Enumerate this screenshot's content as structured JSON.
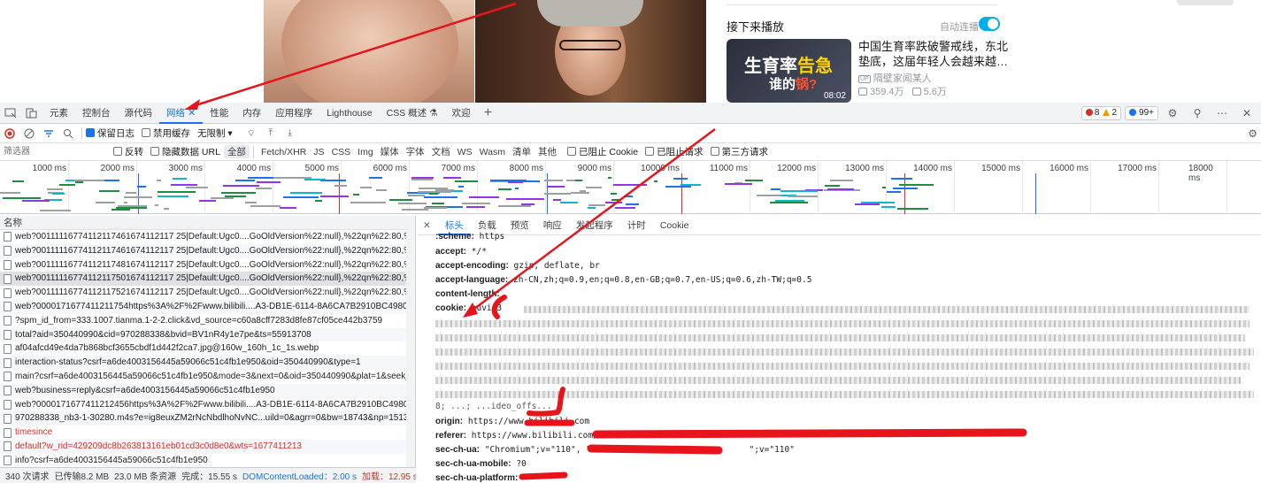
{
  "page": {
    "upnext_title": "接下来播放",
    "autoplay_label": "自动连播",
    "thumb_title_a": "生育率",
    "thumb_title_b": "告急",
    "thumb_sub_a": "谁的",
    "thumb_sub_b": "锅?",
    "thumb_duration": "08:02",
    "video_title": "中国生育率跌破警戒线，东北垫底，这届年轻人会越来越…",
    "video_up": "隔壁家闻某人",
    "video_views": "359.4万",
    "video_comments": "5.6万"
  },
  "devtools": {
    "tabs": [
      "元素",
      "控制台",
      "源代码",
      "网络",
      "性能",
      "内存",
      "应用程序",
      "Lighthouse",
      "CSS 概述",
      "欢迎"
    ],
    "active_tab": "网络",
    "errors": "8",
    "warnings": "2",
    "messages": "99+"
  },
  "toolbar": {
    "preserve_log": "保留日志",
    "disable_cache": "禁用缓存",
    "throttle": "无限制"
  },
  "filter": {
    "placeholder": "筛选器",
    "invert": "反转",
    "hide_data_urls": "隐藏数据 URL",
    "types": [
      "全部",
      "Fetch/XHR",
      "JS",
      "CSS",
      "Img",
      "媒体",
      "字体",
      "文档",
      "WS",
      "Wasm",
      "清单",
      "其他"
    ],
    "blocked_cookies": "已阻止 Cookie",
    "blocked_requests": "已阻止请求",
    "third_party": "第三方请求"
  },
  "timeline": {
    "ticks": [
      "1000 ms",
      "2000 ms",
      "3000 ms",
      "4000 ms",
      "5000 ms",
      "6000 ms",
      "7000 ms",
      "8000 ms",
      "9000 ms",
      "10000 ms",
      "11000 ms",
      "12000 ms",
      "13000 ms",
      "14000 ms",
      "15000 ms",
      "16000 ms",
      "17000 ms",
      "18000 ms"
    ]
  },
  "requests": {
    "column_name": "名称",
    "rows": [
      {
        "name": "web?00111116774112117461674112117 25|Default:Ugc0....GoOldVersion%22:null},%22qn%22:80,%22aq%22:30"
      },
      {
        "name": "web?00111116774112117461674112117 25|Default:Ugc0....GoOldVersion%22:null},%22qn%22:80,%22aq%22:30"
      },
      {
        "name": "web?00111116774112117481674112117 25|Default:Ugc0....GoOldVersion%22:null},%22qn%22:80,%22aq%22:30"
      },
      {
        "name": "web?00111116774112117501674112117 25|Default:Ugc0....GoOldVersion%22:null},%22qn%22:80,%22aq%22:30",
        "selected": true
      },
      {
        "name": "web?00111116774112117521674112117 25|Default:Ugc0....GoOldVersion%22:null},%22qn%22:80,%22aq%22:30"
      },
      {
        "name": "web?0000171677411211754https%3A%2F%2Fwww.bilibili....A3-DB1E-6114-8A6CA7B2910BC49804infoc|zh-CN|."
      },
      {
        "name": "?spm_id_from=333.1007.tianma.1-2-2.click&vd_source=c60a8cff7283d8fe87cf05ce442b3759"
      },
      {
        "name": "total?aid=350440990&cid=970288338&bvid=BV1nR4y1e7pe&ts=55913708"
      },
      {
        "name": "af04afcd49e4da7b868bcf3655cbdf1d442f2ca7.jpg@160w_160h_1c_1s.webp"
      },
      {
        "name": "interaction-status?csrf=a6de4003156445a59066c51c4fb1e950&oid=350440990&type=1"
      },
      {
        "name": "main?csrf=a6de4003156445a59066c51c4fb1e950&mode=3&next=0&oid=350440990&plat=1&seek_rpid=&ty."
      },
      {
        "name": "web?business=reply&csrf=a6de4003156445a59066c51c4fb1e950"
      },
      {
        "name": "web?0000171677411212456https%3A%2F%2Fwww.bilibili....A3-DB1E-6114-8A6CA7B2910BC49804infoc|zh-CN|."
      },
      {
        "name": "970288338_nb3-1-30280.m4s?e=ig8euxZM2rNcNbdlhoNvNC...uild=0&agrr=0&bw=18743&np=151388248&lo"
      },
      {
        "name": "timesince",
        "error": true
      },
      {
        "name": "default?w_rid=429209dc8b263813161eb01cd3c0d8e0&wts=1677411213",
        "error": true
      },
      {
        "name": "info?csrf=a6de4003156445a59066c51c4fb1e950"
      }
    ]
  },
  "status": {
    "requests": "340 次请求",
    "transferred": "已传输8.2 MB",
    "resources": "23.0 MB 条资源",
    "finish": "完成：15.55 s",
    "dcl": "DOMContentLoaded：2.00 s",
    "load": "加载：12.95 s"
  },
  "detail": {
    "tabs": [
      "标头",
      "负载",
      "预览",
      "响应",
      "发起程序",
      "计时",
      "Cookie"
    ],
    "active_tab": "标头",
    "headers": [
      {
        "key": ":scheme:",
        "value": "https"
      },
      {
        "key": "accept:",
        "value": "*/*"
      },
      {
        "key": "accept-encoding:",
        "value": "gzip, deflate, br"
      },
      {
        "key": "accept-language:",
        "value": "zh-CN,zh;q=0.9,en;q=0.8,en-GB;q=0.7,en-US;q=0.6,zh-TW;q=0.5"
      },
      {
        "key": "content-length:",
        "value": ""
      },
      {
        "key": "cookie:",
        "value": "buvid3"
      },
      {
        "key": "origin:",
        "value": "https://www.bilibili.com"
      },
      {
        "key": "referer:",
        "value": "https://www.bilibili.com/vide"
      },
      {
        "key": "sec-ch-ua:",
        "value": "\"Chromium\";v=\"110\", \"Not A"
      },
      {
        "key": "sec-ch-ua-mobile:",
        "value": "?0"
      },
      {
        "key": "sec-ch-ua-platform:",
        "value": "\""
      }
    ],
    "cookie_tail": "8; ...; ...ideo_offs...",
    "ua_tail": "\";v=\"110\""
  }
}
